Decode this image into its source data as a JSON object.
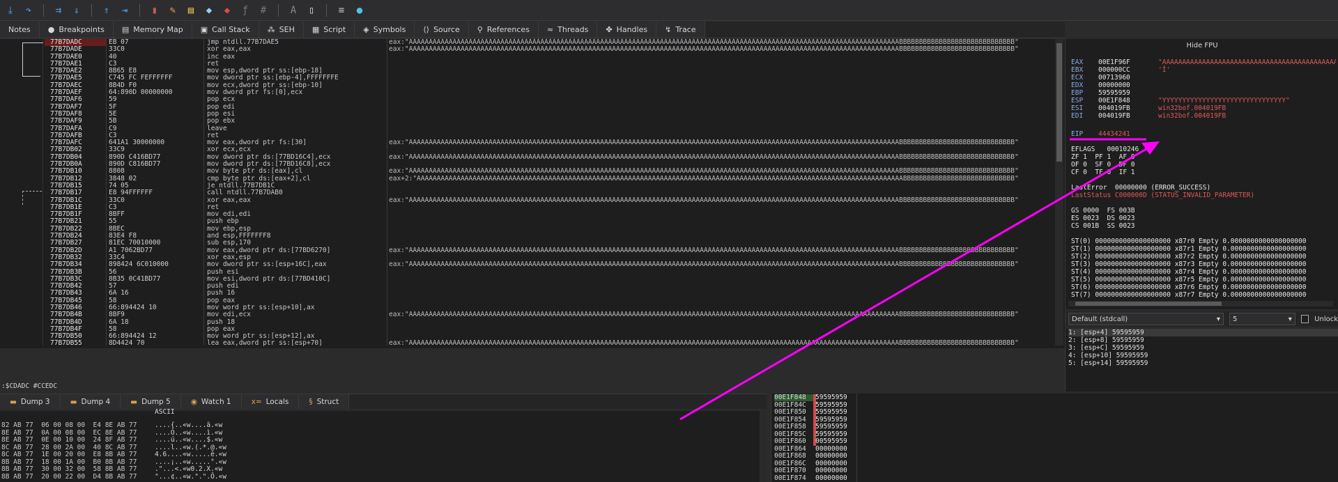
{
  "tabs": [
    {
      "label": "Notes",
      "icon": "notes-icon",
      "glyph": ""
    },
    {
      "label": "Breakpoints",
      "icon": "breakpoint-icon",
      "glyph": "●"
    },
    {
      "label": "Memory Map",
      "icon": "memory-map-icon",
      "glyph": "▤"
    },
    {
      "label": "Call Stack",
      "icon": "call-stack-icon",
      "glyph": "▣"
    },
    {
      "label": "SEH",
      "icon": "seh-icon",
      "glyph": "⁂"
    },
    {
      "label": "Script",
      "icon": "script-icon",
      "glyph": "▦"
    },
    {
      "label": "Symbols",
      "icon": "symbols-icon",
      "glyph": "◈"
    },
    {
      "label": "Source",
      "icon": "source-icon",
      "glyph": "⟨⟩"
    },
    {
      "label": "References",
      "icon": "references-icon",
      "glyph": "⚲"
    },
    {
      "label": "Threads",
      "icon": "threads-icon",
      "glyph": "≈"
    },
    {
      "label": "Handles",
      "icon": "handles-icon",
      "glyph": "✤"
    },
    {
      "label": "Trace",
      "icon": "trace-icon",
      "glyph": "↯"
    }
  ],
  "disasm": {
    "addresses": "77B7DADC\n77B7DADE\n77B7DAE0\n77B7DAE1\n77B7DAE2\n77B7DAE5\n77B7DAEC\n77B7DAEF\n77B7DAF6\n77B7DAF7\n77B7DAF8\n77B7DAF9\n77B7DAFA\n77B7DAFB\n77B7DAFC\n77B7DB02\n77B7DB04\n77B7DB0A\n77B7DB10\n77B7DB12\n77B7DB15\n77B7DB17\n77B7DB1C\n77B7DB1E\n77B7DB1F\n77B7DB21\n77B7DB22\n77B7DB24\n77B7DB27\n77B7DB2D\n77B7DB32\n77B7DB34\n77B7DB3B\n77B7DB3C\n77B7DB42\n77B7DB43\n77B7DB45\n77B7DB46\n77B7DB4B\n77B7DB4D\n77B7DB4F\n77B7DB50\n77B7DB55",
    "bytes": "EB 07\n33C0\n40\nC3\n8B65 E8\nC745 FC FEFFFFFF\n8B4D F0\n64:890D 00000000\n59\n5F\n5E\n5B\nC9\nC3\n641A1 30000000\n33C9\n890D C416BD77\n890D C816BD77\n8808\n3848 02\n74 05\nE8 94FFFFFF\n33C0\nC3\n8BFF\n55\n8BEC\n83E4 F8\n81EC 70010000\nA1 7062BD77\n33C4\n898424 6C010000\n56\n8B35 0C41BD77\n57\n6A 16\n58\n66:894424 10\n8BF9\n6A 18\n58\n66:894424 12\n8D4424 70",
    "instructions": "jmp ntdll.77B7DAE5\nxor eax,eax\ninc eax\nret\nmov esp,dword ptr ss:[ebp-18]\nmov dword ptr ss:[ebp-4],FFFFFFFE\nmov ecx,dword ptr ss:[ebp-10]\nmov dword ptr fs:[0],ecx\npop ecx\npop edi\npop esi\npop ebx\nleave\nret\nmov eax,dword ptr fs:[30]\nxor ecx,ecx\nmov dword ptr ds:[77BD16C4],ecx\nmov dword ptr ds:[77BD16C8],ecx\nmov byte ptr ds:[eax],cl\ncmp byte ptr ds:[eax+2],cl\nje ntdll.77B7DB1C\ncall ntdll.77B7DAB0\nxor eax,eax\nret\nmov edi,edi\npush ebp\nmov ebp,esp\nand esp,FFFFFFF8\nsub esp,170\nmov eax,dword ptr ds:[77BD6270]\nxor eax,esp\nmov dword ptr ss:[esp+16C],eax\npush esi\nmov esi,dword ptr ds:[77BD410C]\npush edi\npush 16\npop eax\nmov word ptr ss:[esp+10],ax\nmov edi,ecx\npush 18\npop eax\nmov word ptr ss:[esp+12],ax\nlea eax,dword ptr ss:[esp+70]",
    "comments": "eax:\"AAAAAAAAAAAAAAAAAAAAAAAAAAAAAAAAAAAAAAAAAAAAAAAAAAAAAAAAAAAAAAAAAAAAAAAAAAAAAAAAAAAAAAAAAAAAAAAAAAAAAAAAAAAAAAAAAAAAAAAAAAABBBBBBBBBBBBBBBBBBBBBBBBBBBBB\"\neax:\"AAAAAAAAAAAAAAAAAAAAAAAAAAAAAAAAAAAAAAAAAAAAAAAAAAAAAAAAAAAAAAAAAAAAAAAAAAAAAAAAAAAAAAAAAAAAAAAAAAAAAAAAAAAAAAAAAAAAAAAAAAABBBBBBBBBBBBBBBBBBBBBBBBBBBBB\"\n\n\n\n\n\n\n\n\n\n\n\n\neax:\"AAAAAAAAAAAAAAAAAAAAAAAAAAAAAAAAAAAAAAAAAAAAAAAAAAAAAAAAAAAAAAAAAAAAAAAAAAAAAAAAAAAAAAAAAAAAAAAAAAAAAAAAAAAAAAAAAAAAAAAAAAABBBBBBBBBBBBBBBBBBBBBBBBBBBBB\"\n\neax:\"AAAAAAAAAAAAAAAAAAAAAAAAAAAAAAAAAAAAAAAAAAAAAAAAAAAAAAAAAAAAAAAAAAAAAAAAAAAAAAAAAAAAAAAAAAAAAAAAAAAAAAAAAAAAAAAAAAAAAAAAAAABBBBBBBBBBBBBBBBBBBBBBBBBBBBB\"\n\neax:\"AAAAAAAAAAAAAAAAAAAAAAAAAAAAAAAAAAAAAAAAAAAAAAAAAAAAAAAAAAAAAAAAAAAAAAAAAAAAAAAAAAAAAAAAAAAAAAAAAAAAAAAAAAAAAAAAAAAAAAAAAAABBBBBBBBBBBBBBBBBBBBBBBBBBBBB\"\neax+2:\"AAAAAAAAAAAAAAAAAAAAAAAAAAAAAAAAAAAAAAAAAAAAAAAAAAAAAAAAAAAAAAAAAAAAAAAAAAAAAAAAAAAAAAAAAAAAAAAAAAAAAAAAAAAAAAAAAAAAAAAAAABBBBBBBBBBBBBBBBBBBBBBBBBBBB\"\n\n\neax:\"AAAAAAAAAAAAAAAAAAAAAAAAAAAAAAAAAAAAAAAAAAAAAAAAAAAAAAAAAAAAAAAAAAAAAAAAAAAAAAAAAAAAAAAAAAAAAAAAAAAAAAAAAAAAAAAAAAAAAAAAAAABBBBBBBBBBBBBBBBBBBBBBBBBBBBB\"\n\n\n\n\n\n\neax:\"AAAAAAAAAAAAAAAAAAAAAAAAAAAAAAAAAAAAAAAAAAAAAAAAAAAAAAAAAAAAAAAAAAAAAAAAAAAAAAAAAAAAAAAAAAAAAAAAAAAAAAAAAAAAAAAAAAAAAAAAAAABBBBBBBBBBBBBBBBBBBBBBBBBBBBB\"\n\neax:\"AAAAAAAAAAAAAAAAAAAAAAAAAAAAAAAAAAAAAAAAAAAAAAAAAAAAAAAAAAAAAAAAAAAAAAAAAAAAAAAAAAAAAAAAAAAAAAAAAAAAAAAAAAAAAAAAAAAAAAAAAAABBBBBBBBBBBBBBBBBBBBBBBBBBBBB\"\n\n\n\n\n\n\neax:\"AAAAAAAAAAAAAAAAAAAAAAAAAAAAAAAAAAAAAAAAAAAAAAAAAAAAAAAAAAAAAAAAAAAAAAAAAAAAAAAAAAAAAAAAAAAAAAAAAAAAAAAAAAAAAAAAAAAAAAAAAAABBBBBBBBBBBBBBBBBBBBBBBBBBBBB\"\n\n\n\neax:\"AAAAAAAAAAAAAAAAAAAAAAAAAAAAAAAAAAAAAAAAAAAAAAAAAAAAAAAAAAAAAAAAAAAAAAAAAAAAAAAAAAAAAAAAAAAAAAAAAAAAAAAAAAAAAAAAAAAAAAAAAAABBBBBBBBBBBBBBBBBBBBBBBBBBBBB\""
  },
  "status_line": ":$CDADC #CCEDC",
  "registers": {
    "hide_fpu": "Hide FPU",
    "gp_names": "EAX\nEBX\nECX\nEDX\nEBP\nESP\nESI\nEDI",
    "gp_values": "00E1F96F\n000000CC\n00713960\n00000000\n59595959\n00E1F848\n004019FB\n004019FB",
    "gp_strings": "\"AAAAAAAAAAAAAAAAAAAAAAAAAAAAAAAAAAAAAAAAAAAAAA\n'Ì'\n\n\n\n\"YYYYYYYYYYYYYYYYYYYYYYYYYYYYYYY\"\nwin32bof.004019FB\nwin32bof.004019FB",
    "eip_name": "EIP",
    "eip_value": "44434241",
    "eflags": "EFLAGS   00010246\nZF 1  PF 1  AF 0\nOF 0  SF 0  DF 0\nCF 0  TF 0  IF 1",
    "last_error": "LastError  00000000 (ERROR_SUCCESS)",
    "last_status": "LastStatus C000000D (STATUS_INVALID_PARAMETER)",
    "segments": "GS 0000  FS 003B\nES 0023  DS 0023\nCS 001B  SS 0023",
    "fpu": "ST(0) 0000000000000000000 x87r0 Empty 0.0000000000000000000\nST(1) 0000000000000000000 x87r1 Empty 0.0000000000000000000\nST(2) 0000000000000000000 x87r2 Empty 0.0000000000000000000\nST(3) 0000000000000000000 x87r3 Empty 0.0000000000000000000\nST(4) 0000000000000000000 x87r4 Empty 0.0000000000000000000\nST(5) 0000000000000000000 x87r5 Empty 0.0000000000000000000\nST(6) 0000000000000000000 x87r6 Empty 0.0000000000000000000\nST(7) 0000000000000000000 x87r7 Empty 0.0000000000000000000"
  },
  "call_convention": {
    "selected": "Default (stdcall)",
    "count": "5",
    "unlock_label": "Unlock"
  },
  "stack_args": [
    "1: [esp+4] 59595959",
    "2: [esp+8] 59595959",
    "3: [esp+C] 59595959",
    "4: [esp+10] 59595959",
    "5: [esp+14] 59595959"
  ],
  "bottom_tabs": [
    {
      "label": "Dump 3",
      "icon": "dump-icon",
      "glyph": "▬"
    },
    {
      "label": "Dump 4",
      "icon": "dump-icon",
      "glyph": "▬"
    },
    {
      "label": "Dump 5",
      "icon": "dump-icon",
      "glyph": "▬"
    },
    {
      "label": "Watch 1",
      "icon": "watch-icon",
      "glyph": "◉"
    },
    {
      "label": "Locals",
      "icon": "locals-icon",
      "glyph": "x="
    },
    {
      "label": "Struct",
      "icon": "struct-icon",
      "glyph": "§"
    }
  ],
  "dump": {
    "ascii_header": "ASCII",
    "hex": "82 AB 77  06 00 08 00  E4 8E AB 77\n8E AB 77  0A 00 08 00  EC 8E AB 77\n8E AB 77  0E 00 10 00  24 8F AB 77\n8C AB 77  28 00 2A 00  40 8C AB 77\n8C AB 77  1E 00 20 00  E8 8B AB 77\n8B AB 77  18 00 1A 00  B0 8B AB 77\n8B AB 77  30 00 32 00  58 8B AB 77\n8B AB 77  20 00 22 00  D4 8B AB 77",
    "ascii": "....{..«w....ä.«w\n....Ò..«w....ì.«w\n....ú..«w....$.«w\n....l..«w.(.*.@.«w\n4.6....«w.....è.«w\n....¡..«w.....°.«w\n.\"...<.«w0.2.X.«w\n\"...¢..«w.\".\".Ô.«w"
  },
  "stack": {
    "addresses": "00E1F848\n00E1F84C\n00E1F850\n00E1F854\n00E1F858\n00E1F85C\n00E1F860\n00E1F864\n00E1F868\n00E1F86C\n00E1F870\n00E1F874",
    "values": "59595959\n59595959\n59595959\n59595959\n59595959\n59595959\n00595959\n00000000\n00000000\n00000000\n00000000\n00000000"
  },
  "colors": {
    "arrow": "#ff00ff",
    "accent_blue": "#4fa3e6",
    "reg_red": "#e05858"
  }
}
